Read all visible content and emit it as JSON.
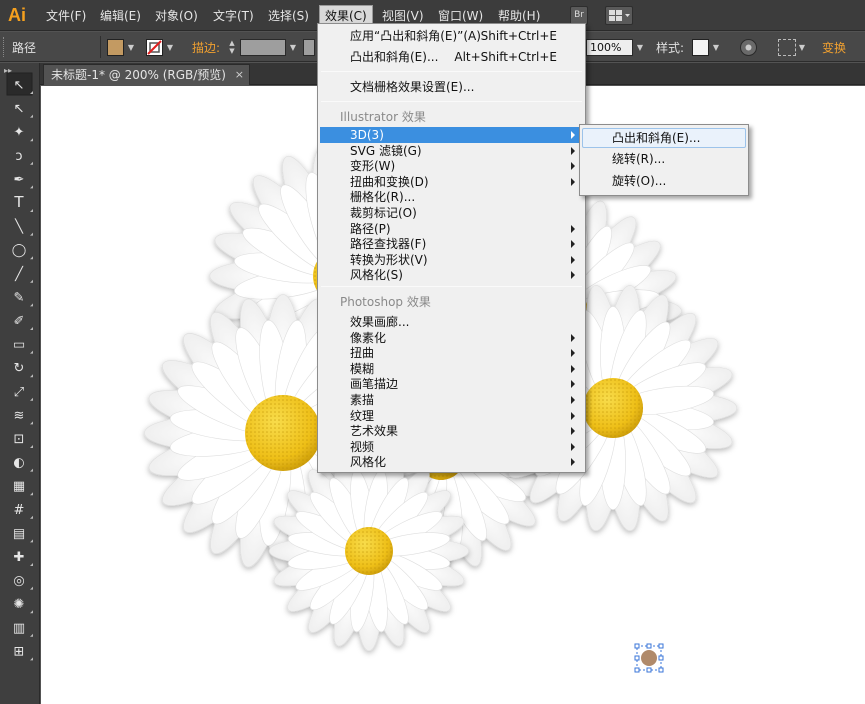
{
  "app": {
    "logo": "Ai"
  },
  "menubar": {
    "items": [
      "文件(F)",
      "编辑(E)",
      "对象(O)",
      "文字(T)",
      "选择(S)",
      "效果(C)",
      "视图(V)",
      "窗口(W)",
      "帮助(H)"
    ],
    "active": "效果(C)",
    "bridge_button": "Br"
  },
  "controlbar": {
    "object_type": "路径",
    "stroke_label": "描边:",
    "opacity_value": "100%",
    "style_label": "样式:",
    "transform_label": "变换",
    "fill_color": "#c39a62",
    "accent_color": "#f0a030"
  },
  "document_tab": {
    "title": "未标题-1* @ 200% (RGB/预览)",
    "close": "×"
  },
  "toolbox": {
    "tools": [
      "selection-tool",
      "direct-selection-tool",
      "magic-wand-tool",
      "lasso-tool",
      "pen-tool",
      "type-tool",
      "line-segment-tool",
      "ellipse-tool",
      "paintbrush-tool",
      "pencil-tool",
      "blob-brush-tool",
      "eraser-tool",
      "rotate-tool",
      "scale-tool",
      "warp-tool",
      "free-transform-tool",
      "shape-builder-tool",
      "perspective-grid-tool",
      "mesh-tool",
      "gradient-tool",
      "eyedropper-tool",
      "blend-tool",
      "symbol-sprayer-tool",
      "column-graph-tool",
      "artboard-tool"
    ]
  },
  "effect_menu": {
    "items": [
      {
        "label": "应用“凸出和斜角(E)”(A)",
        "shortcut": "Shift+Ctrl+E"
      },
      {
        "label": "凸出和斜角(E)...",
        "shortcut": "Alt+Shift+Ctrl+E"
      },
      {
        "label": "文档栅格效果设置(E)..."
      }
    ],
    "illustrator_header": "Illustrator 效果",
    "illustrator_items": [
      {
        "label": "3D(3)",
        "submenu": true,
        "highlighted": true
      },
      {
        "label": "SVG 滤镜(G)",
        "submenu": true
      },
      {
        "label": "变形(W)",
        "submenu": true
      },
      {
        "label": "扭曲和变换(D)",
        "submenu": true
      },
      {
        "label": "栅格化(R)..."
      },
      {
        "label": "裁剪标记(O)"
      },
      {
        "label": "路径(P)",
        "submenu": true
      },
      {
        "label": "路径查找器(F)",
        "submenu": true
      },
      {
        "label": "转换为形状(V)",
        "submenu": true
      },
      {
        "label": "风格化(S)",
        "submenu": true
      }
    ],
    "photoshop_header": "Photoshop 效果",
    "photoshop_items": [
      {
        "label": "效果画廊..."
      },
      {
        "label": "像素化",
        "submenu": true
      },
      {
        "label": "扭曲",
        "submenu": true
      },
      {
        "label": "模糊",
        "submenu": true
      },
      {
        "label": "画笔描边",
        "submenu": true
      },
      {
        "label": "素描",
        "submenu": true
      },
      {
        "label": "纹理",
        "submenu": true
      },
      {
        "label": "艺术效果",
        "submenu": true
      },
      {
        "label": "视频",
        "submenu": true
      },
      {
        "label": "风格化",
        "submenu": true
      }
    ]
  },
  "submenu_3d": {
    "items": [
      "凸出和斜角(E)...",
      "绕转(R)...",
      "旋转(O)..."
    ]
  },
  "canvas": {
    "petal_color": "#ffffff",
    "center_color": "#f1c21b",
    "selected_object_color": "#b08a6a"
  }
}
